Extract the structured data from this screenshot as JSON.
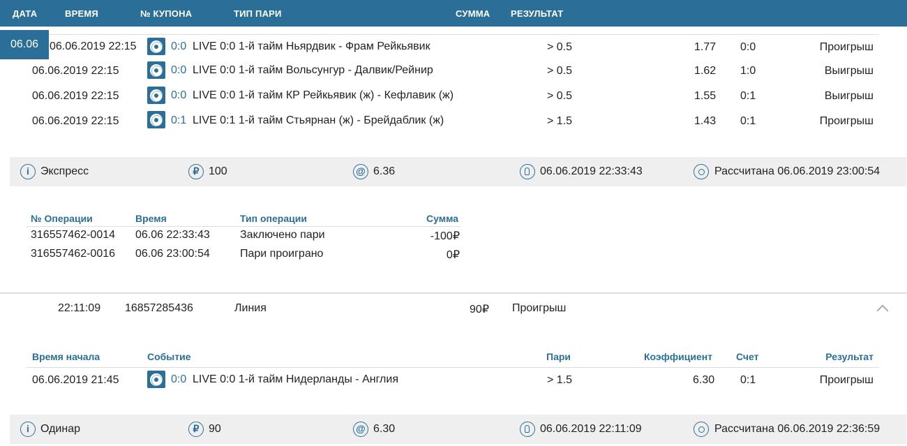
{
  "header": {
    "date": "ДАТА",
    "time": "ВРЕМЯ",
    "coupon": "№ КУПОНА",
    "bet_type": "ТИП ПАРИ",
    "amount": "СУММА",
    "result": "РЕЗУЛЬТАТ"
  },
  "group_date": "06.06",
  "bet1": {
    "events": [
      {
        "datetime": "06.06.2019 22:15",
        "score": "0:0",
        "desc": "LIVE 0:0 1-й тайм Ньярдвик - Фрам Рейкьявик",
        "pick": "> 0.5",
        "odds": "1.77",
        "final": "0:0",
        "result": "Проигрыш"
      },
      {
        "datetime": "06.06.2019 22:15",
        "score": "0:0",
        "desc": "LIVE 0:0 1-й тайм Вольсунгур - Далвик/Рейнир",
        "pick": "> 0.5",
        "odds": "1.62",
        "final": "1:0",
        "result": "Выигрыш"
      },
      {
        "datetime": "06.06.2019 22:15",
        "score": "0:0",
        "desc": "LIVE 0:0 1-й тайм КР Рейкьявик (ж) - Кефлавик (ж)",
        "pick": "> 0.5",
        "odds": "1.55",
        "final": "0:1",
        "result": "Выигрыш"
      },
      {
        "datetime": "06.06.2019 22:15",
        "score": "0:1",
        "desc": "LIVE 0:1 1-й тайм Стьярнан (ж) - Брейдаблик (ж)",
        "pick": "> 1.5",
        "odds": "1.43",
        "final": "0:1",
        "result": "Проигрыш"
      }
    ],
    "summary": {
      "type": "Экспресс",
      "amount": "100",
      "odds": "6.36",
      "placed": "06.06.2019 22:33:43",
      "settled": "Рассчитана 06.06.2019 23:00:54"
    },
    "ops": {
      "headers": {
        "op": "№ Операции",
        "time": "Время",
        "type": "Тип операции",
        "sum": "Сумма"
      },
      "rows": [
        {
          "op": "316557462-0014",
          "time": "06.06 22:33:43",
          "type": "Заключено пари",
          "sum": "-100₽"
        },
        {
          "op": "316557462-0016",
          "time": "06.06 23:00:54",
          "type": "Пари проиграно",
          "sum": "0₽"
        }
      ]
    }
  },
  "bet2": {
    "row": {
      "time": "22:11:09",
      "coupon": "16857285436",
      "type": "Линия",
      "amount": "90₽",
      "result": "Проигрыш"
    },
    "table_headers": {
      "start": "Время начала",
      "event": "Событие",
      "pick": "Пари",
      "odds": "Коэффициент",
      "score": "Счет",
      "result": "Результат"
    },
    "events": [
      {
        "datetime": "06.06.2019 21:45",
        "score": "0:0",
        "desc": "LIVE 0:0 1-й тайм Нидерланды - Англия",
        "pick": "> 1.5",
        "odds": "6.30",
        "final": "0:1",
        "result": "Проигрыш"
      }
    ],
    "summary": {
      "type": "Одинар",
      "amount": "90",
      "odds": "6.30",
      "placed": "06.06.2019 22:11:09",
      "settled": "Рассчитана 06.06.2019 22:36:59"
    }
  },
  "icons": {
    "sport": "soccer-ball-icon",
    "info": "info-icon",
    "ruble": "ruble-icon",
    "odds": "at-icon",
    "placed": "pin-icon",
    "settled": "circle-status-icon",
    "collapse": "chevron-up-icon"
  },
  "colors": {
    "accent": "#2b6f98",
    "summary_bg": "#efefef"
  }
}
